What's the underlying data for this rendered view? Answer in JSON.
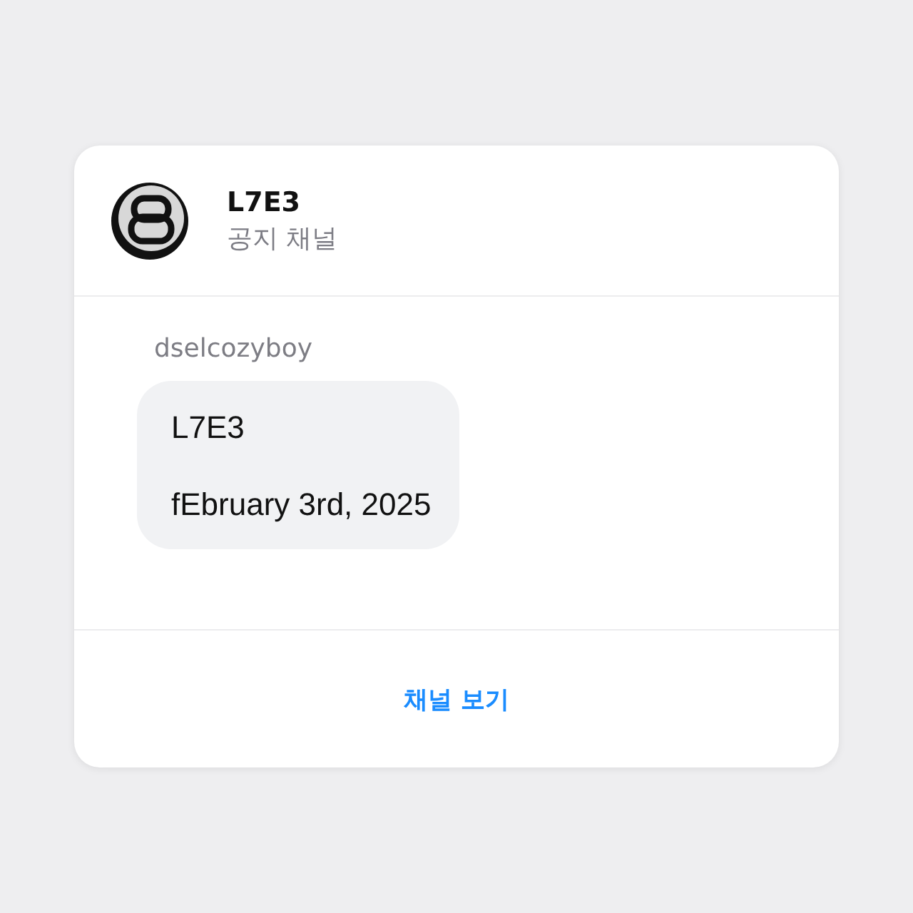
{
  "channel": {
    "name": "L7E3",
    "subtitle": "공지 채널"
  },
  "message": {
    "sender": "dselcozyboy",
    "lines": [
      "L7E3",
      "fEbruary 3rd, 2025"
    ]
  },
  "action": {
    "label": "채널 보기"
  }
}
